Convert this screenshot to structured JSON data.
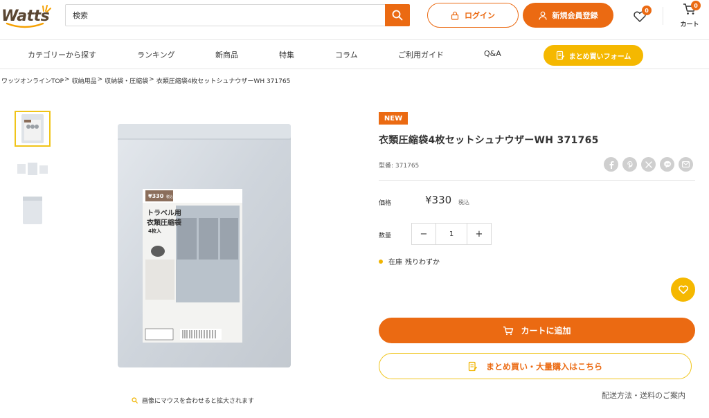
{
  "header": {
    "logo_text": "Watts",
    "search": {
      "placeholder": "検索"
    },
    "login_label": "ログイン",
    "register_label": "新規会員登録",
    "favorites_count": "0",
    "cart_count": "0",
    "cart_label": "カート"
  },
  "nav": {
    "items": [
      {
        "label": "カテゴリーから探す"
      },
      {
        "label": "ランキング"
      },
      {
        "label": "新商品"
      },
      {
        "label": "特集"
      },
      {
        "label": "コラム"
      },
      {
        "label": "ご利用ガイド"
      },
      {
        "label": "Q&A"
      }
    ],
    "bulk_form_label": "まとめ買いフォーム"
  },
  "breadcrumb": [
    {
      "label": "ワッツオンラインTOP"
    },
    {
      "label": "収納用品"
    },
    {
      "label": "収納袋・圧縮袋"
    },
    {
      "label": "衣類圧縮袋4枚セットシュナウザーWH 371765"
    }
  ],
  "breadcrumb_sep": ">",
  "gallery": {
    "zoom_hint": "画像にマウスを合わせると拡大されます",
    "package": {
      "price_tag": "¥330",
      "price_tag_tax": "税込",
      "title_line1": "トラベル用",
      "title_line2": "衣類圧縮袋",
      "count": "4枚入"
    }
  },
  "product": {
    "badge": "NEW",
    "title": "衣類圧縮袋4枚セットシュナウザーWH 371765",
    "sku_label": "型番:",
    "sku_value": "371765",
    "share_icons": [
      "facebook-icon",
      "pinterest-icon",
      "x-icon",
      "line-icon",
      "mail-icon"
    ],
    "price_label": "価格",
    "price": "¥330",
    "tax_label": "税込",
    "quantity_label": "数量",
    "quantity_value": "1",
    "stock_label": "在庫",
    "stock_status": "残りわずか",
    "add_to_cart_label": "カートに追加",
    "bulk_purchase_label": "まとめ買い・大量購入はこちら",
    "delivery_link": "配送方法・送料のご案内"
  },
  "colors": {
    "accent": "#eb6a12",
    "highlight": "#f5b800",
    "thumb_border": "#f0c419"
  }
}
